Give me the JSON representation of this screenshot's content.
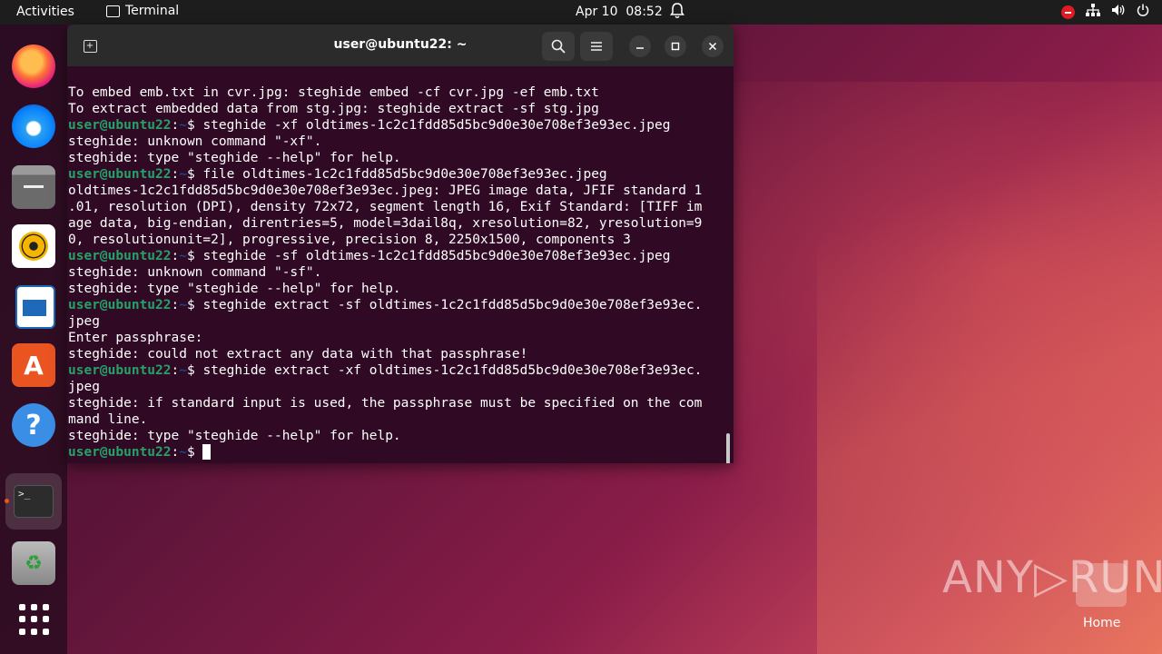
{
  "topbar": {
    "activities": "Activities",
    "app_name": "Terminal",
    "date": "Apr 10",
    "time": "08:52"
  },
  "terminal": {
    "title": "user@ubuntu22: ~",
    "prompt_user": "user@ubuntu22",
    "prompt_sep": ":",
    "prompt_path": "~",
    "prompt_dollar": "$ ",
    "lines": [
      {
        "type": "out",
        "text": "To embed emb.txt in cvr.jpg: steghide embed -cf cvr.jpg -ef emb.txt"
      },
      {
        "type": "out",
        "text": "To extract embedded data from stg.jpg: steghide extract -sf stg.jpg"
      },
      {
        "type": "cmd",
        "text": "steghide -xf oldtimes-1c2c1fdd85d5bc9d0e30e708ef3e93ec.jpeg"
      },
      {
        "type": "out",
        "text": "steghide: unknown command \"-xf\"."
      },
      {
        "type": "out",
        "text": "steghide: type \"steghide --help\" for help."
      },
      {
        "type": "cmd",
        "text": "file oldtimes-1c2c1fdd85d5bc9d0e30e708ef3e93ec.jpeg"
      },
      {
        "type": "out",
        "text": "oldtimes-1c2c1fdd85d5bc9d0e30e708ef3e93ec.jpeg: JPEG image data, JFIF standard 1"
      },
      {
        "type": "out",
        "text": ".01, resolution (DPI), density 72x72, segment length 16, Exif Standard: [TIFF im"
      },
      {
        "type": "out",
        "text": "age data, big-endian, direntries=5, model=3dail8q, xresolution=82, yresolution=9"
      },
      {
        "type": "out",
        "text": "0, resolutionunit=2], progressive, precision 8, 2250x1500, components 3"
      },
      {
        "type": "cmd",
        "text": "steghide -sf oldtimes-1c2c1fdd85d5bc9d0e30e708ef3e93ec.jpeg"
      },
      {
        "type": "out",
        "text": "steghide: unknown command \"-sf\"."
      },
      {
        "type": "out",
        "text": "steghide: type \"steghide --help\" for help."
      },
      {
        "type": "cmd",
        "text": "steghide extract -sf oldtimes-1c2c1fdd85d5bc9d0e30e708ef3e93ec."
      },
      {
        "type": "out",
        "text": "jpeg"
      },
      {
        "type": "out",
        "text": "Enter passphrase:"
      },
      {
        "type": "out",
        "text": "steghide: could not extract any data with that passphrase!"
      },
      {
        "type": "cmd",
        "text": "steghide extract -xf oldtimes-1c2c1fdd85d5bc9d0e30e708ef3e93ec."
      },
      {
        "type": "out",
        "text": "jpeg"
      },
      {
        "type": "out",
        "text": "steghide: if standard input is used, the passphrase must be specified on the com"
      },
      {
        "type": "out",
        "text": "mand line."
      },
      {
        "type": "out",
        "text": "steghide: type \"steghide --help\" for help."
      },
      {
        "type": "cmd",
        "text": ""
      }
    ]
  },
  "dock": {
    "items": [
      "firefox-icon",
      "thunderbird-icon",
      "files-icon",
      "rhythmbox-icon",
      "libreoffice-writer-icon",
      "app-center-icon",
      "help-icon",
      "terminal-icon",
      "trash-icon",
      "show-apps-icon"
    ]
  },
  "desktop": {
    "watermark": "ANY▷RUN",
    "home_label": "Home"
  },
  "colors": {
    "terminal_bg": "#300a24",
    "prompt_user": "#26a269",
    "prompt_path": "#12488b",
    "accent": "#e95420"
  }
}
